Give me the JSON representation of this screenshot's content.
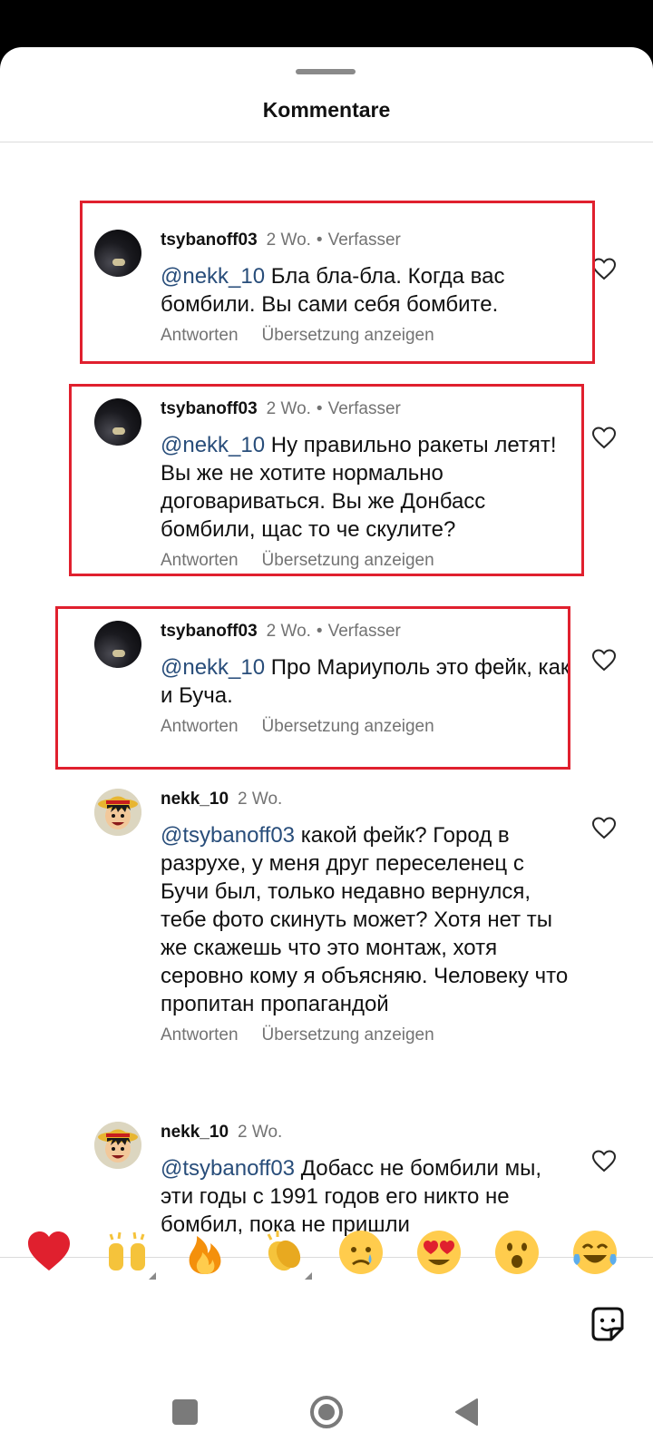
{
  "sheet": {
    "title": "Kommentare"
  },
  "comments": [
    {
      "username": "tsybanoff03",
      "time": "2 Wo.",
      "author_badge": "Verfasser",
      "mention": "@nekk_10",
      "text": " Бла бла-бла. Когда вас бомбили. Вы сами себя бомбите.",
      "reply": "Antworten",
      "translate": "Übersetzung anzeigen",
      "avatar": "dark-night-photo-avatar"
    },
    {
      "username": "tsybanoff03",
      "time": "2 Wo.",
      "author_badge": "Verfasser",
      "mention": "@nekk_10",
      "text": " Ну правильно ракеты летят! Вы же не хотите нормально договариваться. Вы же Донбасс бомбили, щас то че скулите?",
      "reply": "Antworten",
      "translate": "Übersetzung anzeigen",
      "avatar": "dark-night-photo-avatar"
    },
    {
      "username": "tsybanoff03",
      "time": "2 Wo.",
      "author_badge": "Verfasser",
      "mention": "@nekk_10",
      "text": " Про Мариуполь это фейк, как и Буча.",
      "reply": "Antworten",
      "translate": "Übersetzung anzeigen",
      "avatar": "dark-night-photo-avatar"
    },
    {
      "username": "nekk_10",
      "time": "2 Wo.",
      "author_badge": "",
      "mention": "@tsybanoff03",
      "text": " какой фейк? Город в разрухе, у меня друг переселенец с Бучи был, только недавно вернулся, тебе фото скинуть может? Хотя нет ты же скажешь что это монтаж, хотя серовно кому я объясняю. Человеку что пропитан пропагандой",
      "reply": "Antworten",
      "translate": "Übersetzung anzeigen",
      "avatar": "straw-hat-cartoon-avatar"
    },
    {
      "username": "nekk_10",
      "time": "2 Wo.",
      "author_badge": "",
      "mention": "@tsybanoff03",
      "text": " Добасс не бомбили мы, эти годы с 1991 годов его никто не бомбил, пока не пришли",
      "reply": "",
      "translate": "",
      "avatar": "straw-hat-cartoon-avatar"
    }
  ],
  "reactions": [
    "red-heart-emoji",
    "raising-hands-emoji",
    "fire-emoji",
    "clapping-hands-emoji",
    "crying-face-emoji",
    "heart-eyes-emoji",
    "surprised-face-emoji",
    "tears-of-joy-emoji"
  ],
  "composer": {
    "placeholder": ""
  },
  "colors": {
    "highlight_box": "#e0202e",
    "mention": "#284d7a",
    "meta_gray": "#737373"
  }
}
